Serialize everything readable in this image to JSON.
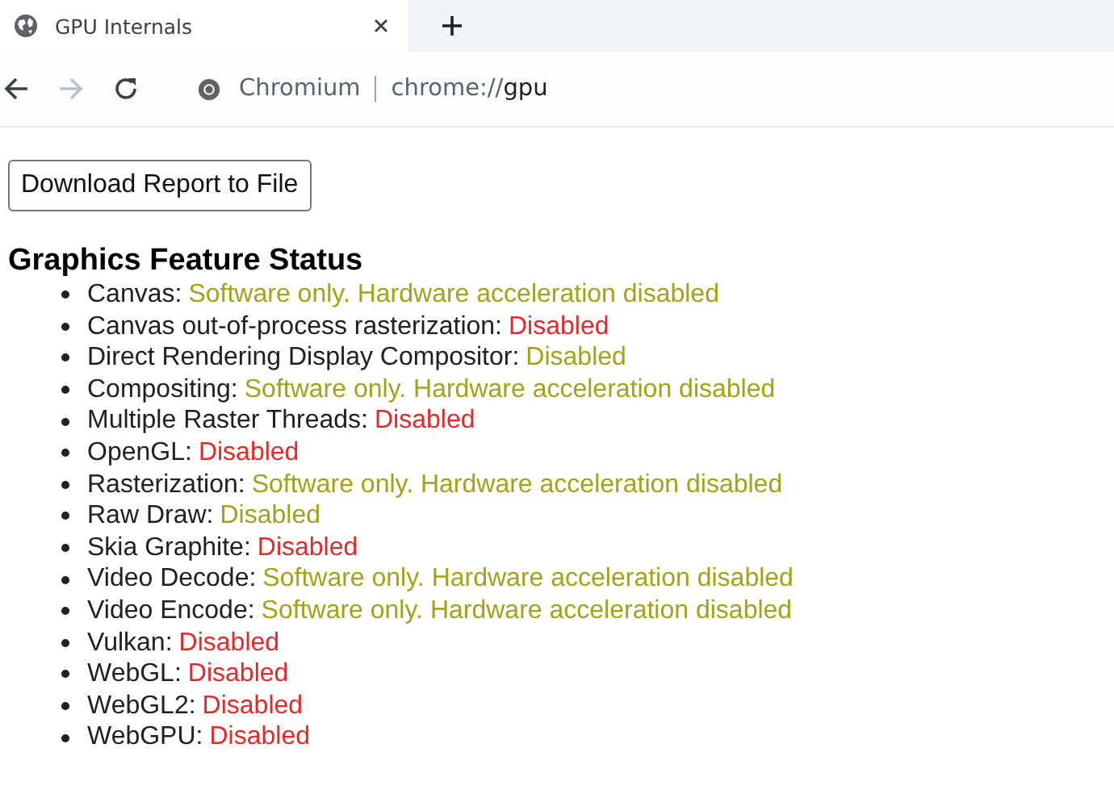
{
  "tab": {
    "title": "GPU Internals",
    "selected": true
  },
  "address": {
    "site": "Chromium",
    "url_prefix": "chrome://",
    "url_path": "gpu"
  },
  "download_button": "Download Report to File",
  "heading": "Graphics Feature Status",
  "features": [
    {
      "name": "Canvas:",
      "status": "Software only. Hardware acceleration disabled",
      "kind": "partial"
    },
    {
      "name": "Canvas out-of-process rasterization:",
      "status": "Disabled",
      "kind": "off"
    },
    {
      "name": "Direct Rendering Display Compositor:",
      "status": "Disabled",
      "kind": "partial"
    },
    {
      "name": "Compositing:",
      "status": "Software only. Hardware acceleration disabled",
      "kind": "partial"
    },
    {
      "name": "Multiple Raster Threads:",
      "status": "Disabled",
      "kind": "off"
    },
    {
      "name": "OpenGL:",
      "status": "Disabled",
      "kind": "off"
    },
    {
      "name": "Rasterization:",
      "status": "Software only. Hardware acceleration disabled",
      "kind": "partial"
    },
    {
      "name": "Raw Draw:",
      "status": "Disabled",
      "kind": "partial"
    },
    {
      "name": "Skia Graphite:",
      "status": "Disabled",
      "kind": "off"
    },
    {
      "name": "Video Decode:",
      "status": "Software only. Hardware acceleration disabled",
      "kind": "partial"
    },
    {
      "name": "Video Encode:",
      "status": "Software only. Hardware acceleration disabled",
      "kind": "partial"
    },
    {
      "name": "Vulkan:",
      "status": "Disabled",
      "kind": "off"
    },
    {
      "name": "WebGL:",
      "status": "Disabled",
      "kind": "off"
    },
    {
      "name": "WebGL2:",
      "status": "Disabled",
      "kind": "off"
    },
    {
      "name": "WebGPU:",
      "status": "Disabled",
      "kind": "off"
    }
  ]
}
